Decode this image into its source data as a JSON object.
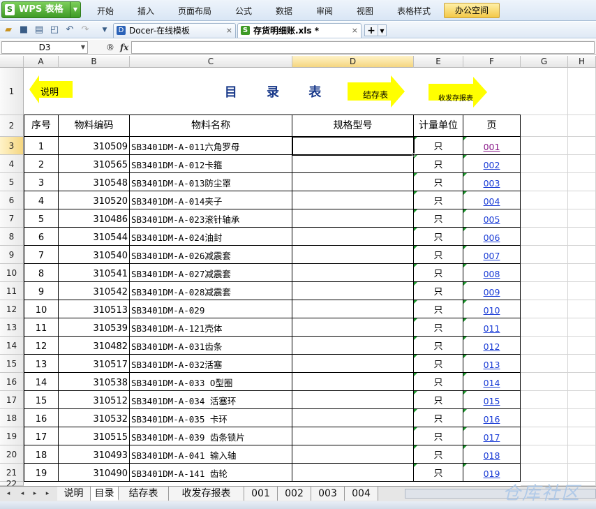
{
  "app": {
    "name": "WPS 表格",
    "logo_letter": "S",
    "menus": [
      "开始",
      "插入",
      "页面布局",
      "公式",
      "数据",
      "审阅",
      "视图",
      "表格样式"
    ],
    "office_menu": "办公空间"
  },
  "doc_tabs": [
    {
      "label": "Docer-在线模板",
      "close": "×"
    },
    {
      "label": "存货明细账.xls *",
      "close": "×"
    }
  ],
  "new_tab": "+",
  "formula_bar": {
    "cell_ref": "D3",
    "fx": "fx",
    "search_glyph": "®",
    "value": ""
  },
  "columns": [
    "A",
    "B",
    "C",
    "D",
    "E",
    "F",
    "G",
    "H"
  ],
  "selected_column": "D",
  "selected_row": 3,
  "row1": {
    "title": "目  录  表",
    "left_arrow": "说明",
    "right_arrow1": "结存表",
    "right_arrow2": "收发存报表"
  },
  "headers": [
    "序号",
    "物料编码",
    "物料名称",
    "规格型号",
    "计量单位",
    "页"
  ],
  "rows": [
    {
      "row": 3,
      "no": "1",
      "code": "310509",
      "name": "SB3401DM-A-011六角罗母",
      "spec": "",
      "unit": "只",
      "page": "001",
      "visited": true
    },
    {
      "row": 4,
      "no": "2",
      "code": "310565",
      "name": "SB3401DM-A-012卡箍",
      "spec": "",
      "unit": "只",
      "page": "002",
      "visited": false
    },
    {
      "row": 5,
      "no": "3",
      "code": "310548",
      "name": "SB3401DM-A-013防尘罩",
      "spec": "",
      "unit": "只",
      "page": "003",
      "visited": false
    },
    {
      "row": 6,
      "no": "4",
      "code": "310520",
      "name": "SB3401DM-A-014夹子",
      "spec": "",
      "unit": "只",
      "page": "004",
      "visited": false
    },
    {
      "row": 7,
      "no": "5",
      "code": "310486",
      "name": "SB3401DM-A-023滚针轴承",
      "spec": "",
      "unit": "只",
      "page": "005",
      "visited": false
    },
    {
      "row": 8,
      "no": "6",
      "code": "310544",
      "name": "SB3401DM-A-024油封",
      "spec": "",
      "unit": "只",
      "page": "006",
      "visited": false
    },
    {
      "row": 9,
      "no": "7",
      "code": "310540",
      "name": "SB3401DM-A-026减震套",
      "spec": "",
      "unit": "只",
      "page": "007",
      "visited": false
    },
    {
      "row": 10,
      "no": "8",
      "code": "310541",
      "name": "SB3401DM-A-027减震套",
      "spec": "",
      "unit": "只",
      "page": "008",
      "visited": false
    },
    {
      "row": 11,
      "no": "9",
      "code": "310542",
      "name": "SB3401DM-A-028减震套",
      "spec": "",
      "unit": "只",
      "page": "009",
      "visited": false
    },
    {
      "row": 12,
      "no": "10",
      "code": "310513",
      "name": "SB3401DM-A-029",
      "spec": "",
      "unit": "只",
      "page": "010",
      "visited": false
    },
    {
      "row": 13,
      "no": "11",
      "code": "310539",
      "name": "SB3401DM-A-121壳体",
      "spec": "",
      "unit": "只",
      "page": "011",
      "visited": false
    },
    {
      "row": 14,
      "no": "12",
      "code": "310482",
      "name": "SB3401DM-A-031齿条",
      "spec": "",
      "unit": "只",
      "page": "012",
      "visited": false
    },
    {
      "row": 15,
      "no": "13",
      "code": "310517",
      "name": "SB3401DM-A-032活塞",
      "spec": "",
      "unit": "只",
      "page": "013",
      "visited": false
    },
    {
      "row": 16,
      "no": "14",
      "code": "310538",
      "name": "SB3401DM-A-033 O型圈",
      "spec": "",
      "unit": "只",
      "page": "014",
      "visited": false
    },
    {
      "row": 17,
      "no": "15",
      "code": "310512",
      "name": "SB3401DM-A-034 活塞环",
      "spec": "",
      "unit": "只",
      "page": "015",
      "visited": false
    },
    {
      "row": 18,
      "no": "16",
      "code": "310532",
      "name": "SB3401DM-A-035 卡环",
      "spec": "",
      "unit": "只",
      "page": "016",
      "visited": false
    },
    {
      "row": 19,
      "no": "17",
      "code": "310515",
      "name": "SB3401DM-A-039 齿条锁片",
      "spec": "",
      "unit": "只",
      "page": "017",
      "visited": false
    },
    {
      "row": 20,
      "no": "18",
      "code": "310493",
      "name": "SB3401DM-A-041 输入轴",
      "spec": "",
      "unit": "只",
      "page": "018",
      "visited": false
    },
    {
      "row": 21,
      "no": "19",
      "code": "310490",
      "name": "SB3401DM-A-141 齿轮",
      "spec": "",
      "unit": "只",
      "page": "019",
      "visited": false
    }
  ],
  "sheet_tabs": [
    "说明",
    "目录",
    "结存表",
    "收发存报表",
    "001",
    "002",
    "003",
    "004"
  ],
  "active_sheet": "目录",
  "watermark": "仓库社区",
  "colors": {
    "accent_green": "#3e9a26",
    "link": "#1a3cd6",
    "visited_link": "#8a1a8a",
    "arrow_yellow": "#ffff00",
    "title_blue": "#1a3a8a"
  }
}
